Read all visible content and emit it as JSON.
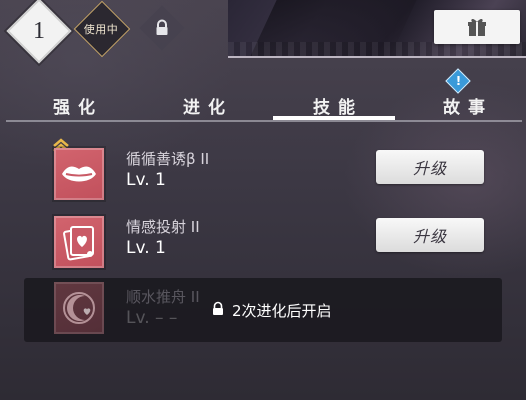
{
  "header": {
    "level_number": "1",
    "in_use_label": "使用中",
    "icons": [
      "lock-icon",
      "gift-icon"
    ]
  },
  "tabs": [
    {
      "label": "强化",
      "active": false
    },
    {
      "label": "进化",
      "active": false
    },
    {
      "label": "技能",
      "active": true
    },
    {
      "label": "故事",
      "active": false,
      "notice": "!"
    }
  ],
  "skills": [
    {
      "name": "循循善诱β II",
      "level": "Lv. 1",
      "button": "升级",
      "icon": "lips-icon",
      "upgrade_available": true
    },
    {
      "name": "情感投射 II",
      "level": "Lv. 1",
      "button": "升级",
      "icon": "heart-card-icon"
    },
    {
      "name": "顺水推舟 II",
      "level": "Lv. – –",
      "locked": true,
      "unlock_text": "2次进化后开启",
      "icon": "moon-heart-icon"
    }
  ],
  "colors": {
    "skill_icon": "#c95a66",
    "active_tab": "#ffffff",
    "notice": "#3a9ad9",
    "in_use_border": "#c8a76a"
  }
}
